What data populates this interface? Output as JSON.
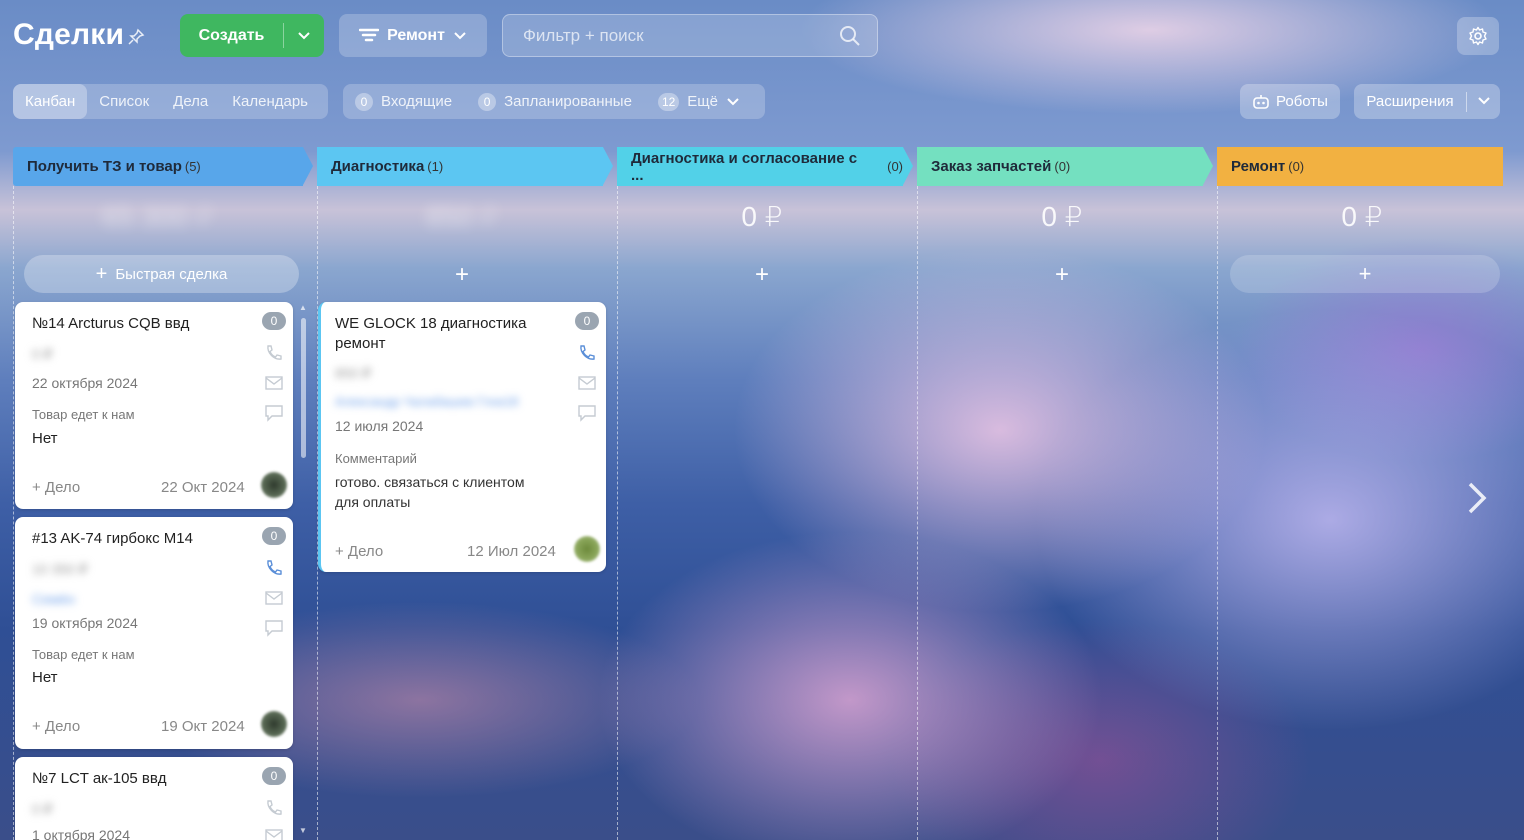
{
  "header": {
    "title": "Сделки",
    "create_label": "Создать",
    "category_label": "Ремонт",
    "search_placeholder": "Фильтр + поиск"
  },
  "views": [
    "Канбан",
    "Список",
    "Дела",
    "Календарь"
  ],
  "counters": [
    {
      "count": "0",
      "label": "Входящие"
    },
    {
      "count": "0",
      "label": "Запланированные"
    },
    {
      "count": "12",
      "label": "Ещё"
    }
  ],
  "toolbar": {
    "robots_label": "Роботы",
    "extensions_label": "Расширения"
  },
  "colors": {
    "accent": "#3fb760",
    "stage1": "#58a6ea",
    "stage2": "#5cc6f2",
    "stage3": "#52d1e8",
    "stage4": "#74e0c0",
    "stage5": "#f2b141"
  },
  "columns": [
    {
      "name": "Получить ТЗ и товар",
      "count": "(5)",
      "sum": "65 300 ₽",
      "quick_deal": "Быстрая сделка"
    },
    {
      "name": "Диагностика",
      "count": "(1)",
      "sum": "850 ₽"
    },
    {
      "name": "Диагностика и согласование с ...",
      "count": "(0)",
      "sum": "0 ₽"
    },
    {
      "name": "Заказ запчастей",
      "count": "(0)",
      "sum": "0 ₽"
    },
    {
      "name": "Ремонт",
      "count": "(0)",
      "sum": "0 ₽"
    }
  ],
  "cards": [
    {
      "title": "№14 Arcturus CQB ввд",
      "badge": "0",
      "amount": "0 ₽",
      "date": "22 октября 2024",
      "field_label": "Товар едет к нам",
      "field_value": "Нет",
      "add_task": "+ Дело",
      "footer_date": "22 Окт 2024"
    },
    {
      "title": "#13 AK-74 гирбокс M14",
      "badge": "0",
      "amount": "10 350 ₽",
      "contact": "Семён",
      "date": "19 октября 2024",
      "field_label": "Товар едет к нам",
      "field_value": "Нет",
      "add_task": "+ Дело",
      "footer_date": "19 Окт 2024"
    },
    {
      "title": "№7 LCT ак-105 ввд",
      "badge": "0",
      "amount": "0 ₽",
      "date": "1 октября 2024"
    },
    {
      "title_line1": "WE GLOCK 18 диагностика",
      "title_line2": "ремонт",
      "badge": "0",
      "amount": "850 ₽",
      "contact": "Александр Чалабашев Глок18",
      "date": "12 июля 2024",
      "field_label": "Комментарий",
      "comment_line1": "готово. связаться с клиентом",
      "comment_line2": "для оплаты",
      "add_task": "+ Дело",
      "footer_date": "12 Июл 2024"
    }
  ]
}
